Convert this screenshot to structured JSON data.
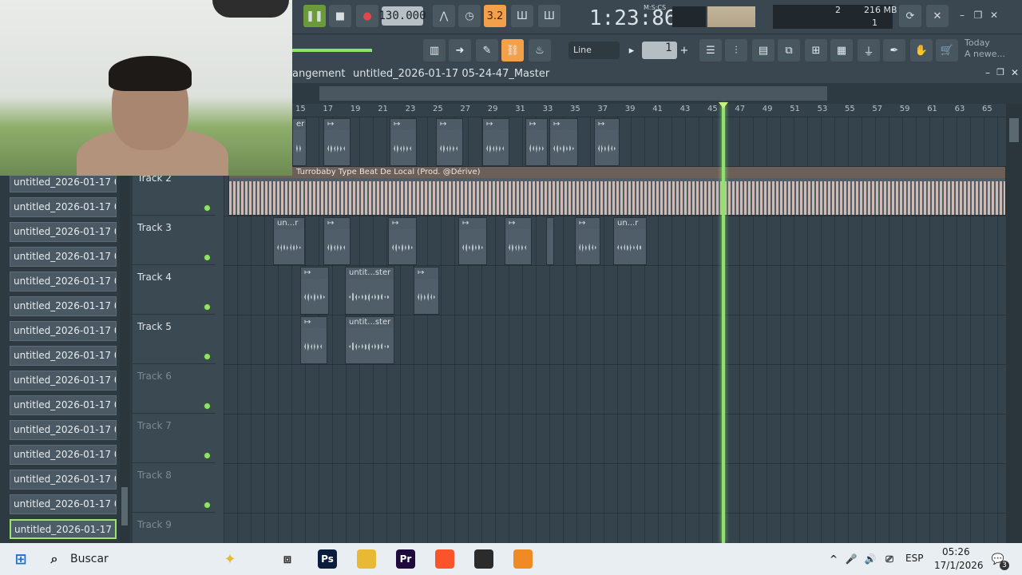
{
  "toolbar": {
    "tempo": "130.000",
    "time_display": "1:23:86",
    "time_format": "M:S:CS",
    "cpu_value": "2",
    "memory": "216 MB",
    "voices": "1",
    "accent_color": "#f3a04a"
  },
  "toolbar2": {
    "snap_mode": "Line",
    "pattern_number": "1",
    "hint_line1": "Today",
    "hint_line2": "A newe..."
  },
  "playlist": {
    "title_prefix": "angement",
    "title_name": "untitled_2026-01-17 05-24-47_Master",
    "ruler_bars": [
      "15",
      "17",
      "19",
      "21",
      "23",
      "25",
      "27",
      "29",
      "31",
      "33",
      "35",
      "37",
      "39",
      "41",
      "43",
      "45",
      "47",
      "49",
      "51",
      "53",
      "55",
      "57",
      "59",
      "61",
      "63",
      "65"
    ],
    "tracks": [
      {
        "name": "Track 2",
        "dim": false
      },
      {
        "name": "Track 3",
        "dim": false
      },
      {
        "name": "Track 4",
        "dim": false
      },
      {
        "name": "Track 5",
        "dim": false
      },
      {
        "name": "Track 6",
        "dim": true
      },
      {
        "name": "Track 7",
        "dim": true
      },
      {
        "name": "Track 8",
        "dim": true
      },
      {
        "name": "Track 9",
        "dim": true
      }
    ],
    "big_clip_label": "Turrobaby Type Beat  De Local (Prod. @Dérive)",
    "clip_labels": {
      "t1_first": "er",
      "t3_first": "un...r",
      "t3_last": "un...r",
      "t4_second": "untit...ster",
      "t5_second": "untit...ster"
    },
    "playhead_color": "#8fe36a"
  },
  "browser": {
    "items": [
      "untitled_2026-01-17 05-...",
      "untitled_2026-01-17 05-...",
      "untitled_2026-01-17 05-...",
      "untitled_2026-01-17 05-...",
      "untitled_2026-01-17 05-...",
      "untitled_2026-01-17 05-...",
      "untitled_2026-01-17 05-...",
      "untitled_2026-01-17 05-...",
      "untitled_2026-01-17 05-...",
      "untitled_2026-01-17 05-...",
      "untitled_2026-01-17 05-...",
      "untitled_2026-01-17 05-...",
      "untitled_2026-01-17 05-...",
      "untitled_2026-01-17 05-...",
      "untitled_2026-01-17 05-..."
    ],
    "selected_index": 14
  },
  "taskbar": {
    "search_label": "Buscar",
    "language": "ESP",
    "time": "05:26",
    "date": "17/1/2026",
    "notification_count": "3",
    "apps": [
      {
        "name": "photoshop-icon",
        "label": "Ps",
        "color": "#0a1d3d"
      },
      {
        "name": "file-explorer-icon",
        "label": "",
        "color": "#e8b934"
      },
      {
        "name": "premiere-icon",
        "label": "Pr",
        "color": "#1f0a3d"
      },
      {
        "name": "brave-icon",
        "label": "",
        "color": "#fb542b"
      },
      {
        "name": "obs-icon",
        "label": "",
        "color": "#2b2b2b"
      },
      {
        "name": "fl-studio-icon",
        "label": "",
        "color": "#f08a24"
      }
    ]
  }
}
